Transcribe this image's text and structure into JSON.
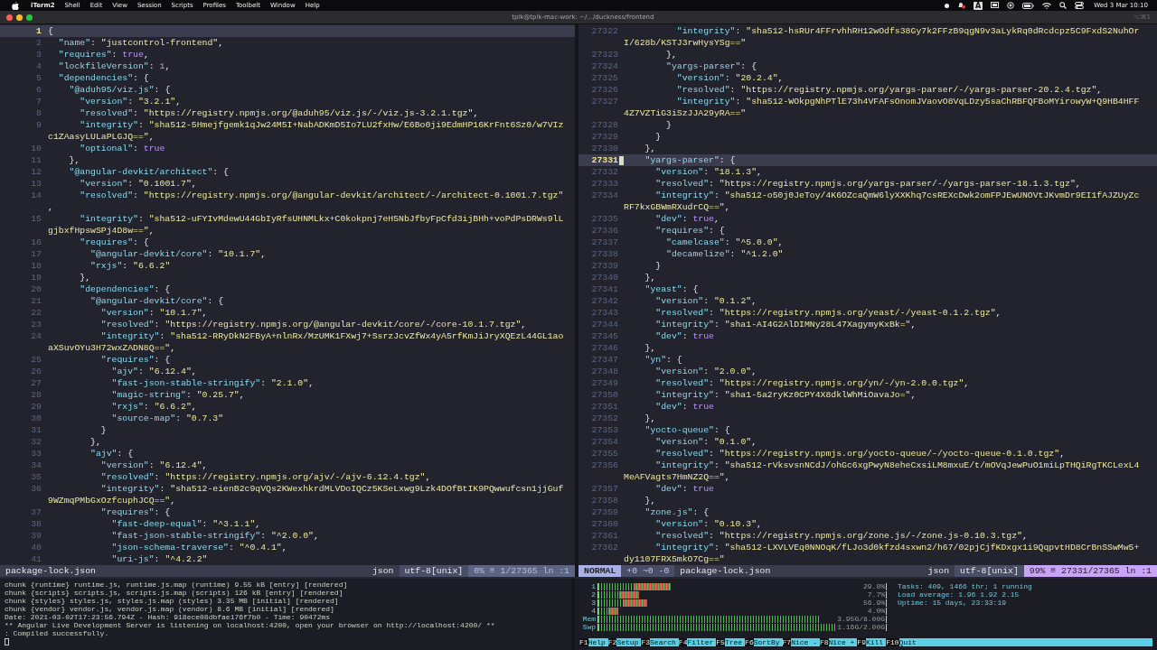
{
  "menubar": {
    "app_name": "iTerm2",
    "menus": [
      "Shell",
      "Edit",
      "View",
      "Session",
      "Scripts",
      "Profiles",
      "Toolbelt",
      "Window",
      "Help"
    ],
    "input_source": "A",
    "clock": "Wed 3 Mar 10:10"
  },
  "window": {
    "title": "tplk@tplk-mac-work: ~/.../duckness/frontend",
    "shortcut": "⌥⌘1"
  },
  "panes": [
    {
      "active": false,
      "lines": [
        {
          "number": "1",
          "text": "{",
          "current": true
        },
        {
          "number": "2",
          "text": "  \"name\": \"justcontrol-frontend\",",
          "current": false
        },
        {
          "number": "3",
          "text": "  \"requires\": true,",
          "current": false
        },
        {
          "number": "4",
          "text": "  \"lockfileVersion\": 1,",
          "current": false
        },
        {
          "number": "5",
          "text": "  \"dependencies\": {",
          "current": false
        },
        {
          "number": "6",
          "text": "    \"@aduh95/viz.js\": {",
          "current": false
        },
        {
          "number": "7",
          "text": "      \"version\": \"3.2.1\",",
          "current": false
        },
        {
          "number": "8",
          "text": "      \"resolved\": \"https://registry.npmjs.org/@aduh95/viz.js/-/viz.js-3.2.1.tgz\",",
          "current": false
        },
        {
          "number": "9",
          "text": "      \"integrity\": \"sha512-5Hmejfgemk1qJw24M5I+NabADKmD5Io7LU2fxHw/E6Bo0ji9EdmHP16KrFnt6Sz0/w7VIz",
          "continuation": "c1ZAasyLULaPLGJQ==\",",
          "current": false
        },
        {
          "number": "10",
          "text": "      \"optional\": true",
          "current": false
        },
        {
          "number": "11",
          "text": "    },",
          "current": false
        },
        {
          "number": "12",
          "text": "    \"@angular-devkit/architect\": {",
          "current": false
        },
        {
          "number": "13",
          "text": "      \"version\": \"0.1001.7\",",
          "current": false
        },
        {
          "number": "14",
          "text": "      \"resolved\": \"https://registry.npmjs.org/@angular-devkit/architect/-/architect-0.1001.7.tgz\"",
          "continuation": ",",
          "current": false
        },
        {
          "number": "15",
          "text": "      \"integrity\": \"sha512-uFYIvMdewU44GbIyRfsUHNMLkx+C0kokpnj7eH5NbJfbyFpCfd3ijBHh+voPdPsDRWs9lL",
          "continuation": "gjbxfHpswSPj4D8w==\",",
          "current": false
        },
        {
          "number": "16",
          "text": "      \"requires\": {",
          "current": false
        },
        {
          "number": "17",
          "text": "        \"@angular-devkit/core\": \"10.1.7\",",
          "current": false
        },
        {
          "number": "18",
          "text": "        \"rxjs\": \"6.6.2\"",
          "current": false
        },
        {
          "number": "19",
          "text": "      },",
          "current": false
        },
        {
          "number": "20",
          "text": "      \"dependencies\": {",
          "current": false
        },
        {
          "number": "21",
          "text": "        \"@angular-devkit/core\": {",
          "current": false
        },
        {
          "number": "22",
          "text": "          \"version\": \"10.1.7\",",
          "current": false
        },
        {
          "number": "23",
          "text": "          \"resolved\": \"https://registry.npmjs.org/@angular-devkit/core/-/core-10.1.7.tgz\",",
          "current": false
        },
        {
          "number": "24",
          "text": "          \"integrity\": \"sha512-RRyDkN2FByA+nlnRx/MzUMK1FXwj7+SsrzJcvZfWx4yA5rfKmJiJryXQEzL44GL1ao",
          "continuation": "aXSuvOYu3H72wxZADN8Q==\",",
          "current": false
        },
        {
          "number": "25",
          "text": "          \"requires\": {",
          "current": false
        },
        {
          "number": "26",
          "text": "            \"ajv\": \"6.12.4\",",
          "current": false
        },
        {
          "number": "27",
          "text": "            \"fast-json-stable-stringify\": \"2.1.0\",",
          "current": false
        },
        {
          "number": "28",
          "text": "            \"magic-string\": \"0.25.7\",",
          "current": false
        },
        {
          "number": "29",
          "text": "            \"rxjs\": \"6.6.2\",",
          "current": false
        },
        {
          "number": "30",
          "text": "            \"source-map\": \"0.7.3\"",
          "current": false
        },
        {
          "number": "31",
          "text": "          }",
          "current": false
        },
        {
          "number": "32",
          "text": "        },",
          "current": false
        },
        {
          "number": "33",
          "text": "        \"ajv\": {",
          "current": false
        },
        {
          "number": "34",
          "text": "          \"version\": \"6.12.4\",",
          "current": false
        },
        {
          "number": "35",
          "text": "          \"resolved\": \"https://registry.npmjs.org/ajv/-/ajv-6.12.4.tgz\",",
          "current": false
        },
        {
          "number": "36",
          "text": "          \"integrity\": \"sha512-eienB2c9qVQs2KWexhkrdMLVDoIQCz5KSeLxwg9Lzk4DOfBtIK9PQwwufcsn1jjGuf",
          "continuation": "9WZmqPMbGxOzfcuphJCQ==\",",
          "current": false
        },
        {
          "number": "37",
          "text": "          \"requires\": {",
          "current": false
        },
        {
          "number": "38",
          "text": "            \"fast-deep-equal\": \"^3.1.1\",",
          "current": false
        },
        {
          "number": "39",
          "text": "            \"fast-json-stable-stringify\": \"^2.0.0\",",
          "current": false
        },
        {
          "number": "40",
          "text": "            \"json-schema-traverse\": \"^0.4.1\",",
          "current": false
        },
        {
          "number": "41",
          "text": "            \"uri-js\": \"^4.2.2\"",
          "current": false
        }
      ],
      "status": {
        "file": "package-lock.json",
        "filetype": "json",
        "encoding": "utf-8[unix]",
        "position": "0% ≡ 1/27365 ln :1"
      }
    },
    {
      "active": true,
      "lines": [
        {
          "number": "27322",
          "text": "          \"integrity\": \"sha512-hsRUr4FFrvhhRH12wOdfs38Gy7k2FFzB9qgN9v3aLykRq0dRcdcpz5C9FxdS2NuhOr",
          "continuation": "I/628b/KSTJ3rwHysYSg==\"",
          "current": false
        },
        {
          "number": "27323",
          "text": "        },",
          "current": false
        },
        {
          "number": "27324",
          "text": "        \"yargs-parser\": {",
          "current": false
        },
        {
          "number": "27325",
          "text": "          \"version\": \"20.2.4\",",
          "current": false
        },
        {
          "number": "27326",
          "text": "          \"resolved\": \"https://registry.npmjs.org/yargs-parser/-/yargs-parser-20.2.4.tgz\",",
          "current": false
        },
        {
          "number": "27327",
          "text": "          \"integrity\": \"sha512-WOkpgNhPTlE73h4VFAFsOnomJVaovO8VqLDzy5saChRBFQFBoMYirowyW+Q9HB4HFF",
          "continuation": "4Z7VZTiG3iSzJJA29yRA==\"",
          "current": false
        },
        {
          "number": "27328",
          "text": "        }",
          "current": false
        },
        {
          "number": "27329",
          "text": "      }",
          "current": false
        },
        {
          "number": "27330",
          "text": "    },",
          "current": false
        },
        {
          "number": "27331",
          "text": "    \"yargs-parser\": {",
          "current": true
        },
        {
          "number": "27332",
          "text": "      \"version\": \"18.1.3\",",
          "current": false
        },
        {
          "number": "27333",
          "text": "      \"resolved\": \"https://registry.npmjs.org/yargs-parser/-/yargs-parser-18.1.3.tgz\",",
          "current": false
        },
        {
          "number": "27334",
          "text": "      \"integrity\": \"sha512-o50j0JeToy/4K6OZcaQmW6lyXXKhq7csREXcDwk2omFPJEwUNOVtJKvmDr9EI1fAJZUyZc",
          "continuation": "RF7kxGBWmRXudrCQ==\",",
          "current": false
        },
        {
          "number": "27335",
          "text": "      \"dev\": true,",
          "current": false
        },
        {
          "number": "27336",
          "text": "      \"requires\": {",
          "current": false
        },
        {
          "number": "27337",
          "text": "        \"camelcase\": \"^5.0.0\",",
          "current": false
        },
        {
          "number": "27338",
          "text": "        \"decamelize\": \"^1.2.0\"",
          "current": false
        },
        {
          "number": "27339",
          "text": "      }",
          "current": false
        },
        {
          "number": "27340",
          "text": "    },",
          "current": false
        },
        {
          "number": "27341",
          "text": "    \"yeast\": {",
          "current": false
        },
        {
          "number": "27342",
          "text": "      \"version\": \"0.1.2\",",
          "current": false
        },
        {
          "number": "27343",
          "text": "      \"resolved\": \"https://registry.npmjs.org/yeast/-/yeast-0.1.2.tgz\",",
          "current": false
        },
        {
          "number": "27344",
          "text": "      \"integrity\": \"sha1-AI4G2AlDIMNy28L47XagymyKxBk=\",",
          "current": false
        },
        {
          "number": "27345",
          "text": "      \"dev\": true",
          "current": false
        },
        {
          "number": "27346",
          "text": "    },",
          "current": false
        },
        {
          "number": "27347",
          "text": "    \"yn\": {",
          "current": false
        },
        {
          "number": "27348",
          "text": "      \"version\": \"2.0.0\",",
          "current": false
        },
        {
          "number": "27349",
          "text": "      \"resolved\": \"https://registry.npmjs.org/yn/-/yn-2.0.0.tgz\",",
          "current": false
        },
        {
          "number": "27350",
          "text": "      \"integrity\": \"sha1-5a2ryKz0CPY4X8dklWhMiOavaJo=\",",
          "current": false
        },
        {
          "number": "27351",
          "text": "      \"dev\": true",
          "current": false
        },
        {
          "number": "27352",
          "text": "    },",
          "current": false
        },
        {
          "number": "27353",
          "text": "    \"yocto-queue\": {",
          "current": false
        },
        {
          "number": "27354",
          "text": "      \"version\": \"0.1.0\",",
          "current": false
        },
        {
          "number": "27355",
          "text": "      \"resolved\": \"https://registry.npmjs.org/yocto-queue/-/yocto-queue-0.1.0.tgz\",",
          "current": false
        },
        {
          "number": "27356",
          "text": "      \"integrity\": \"sha512-rVksvsnNCdJ/ohGc6xgPwyN8eheCxsiLM8mxuE/t/mOVqJewPuO1miLpTHQiRgTKCLexL4",
          "continuation": "MeAFVagts7HmNZ2Q==\",",
          "current": false
        },
        {
          "number": "27357",
          "text": "      \"dev\": true",
          "current": false
        },
        {
          "number": "27358",
          "text": "    },",
          "current": false
        },
        {
          "number": "27359",
          "text": "    \"zone.js\": {",
          "current": false
        },
        {
          "number": "27360",
          "text": "      \"version\": \"0.10.3\",",
          "current": false
        },
        {
          "number": "27361",
          "text": "      \"resolved\": \"https://registry.npmjs.org/zone.js/-/zone.js-0.10.3.tgz\",",
          "current": false
        },
        {
          "number": "27362",
          "text": "      \"integrity\": \"sha512-LXVLVEq0NNOqK/fLJo3d0kfzd4sxwn2/h67/02pjCjfKDxgx1i9QqpvtHD8CrBnSSwMw5+",
          "continuation": "dy1107FRX5mkO7Cg==\"",
          "current": false
        }
      ],
      "status": {
        "mode": "NORMAL",
        "git": "+0 ~0 -0",
        "file": "package-lock.json",
        "filetype": "json",
        "encoding": "utf-8[unix]",
        "position": "99% ≡ 27331/27365 ln :1"
      }
    }
  ],
  "terminal": {
    "lines": [
      "chunk {runtime} runtime.js, runtime.js.map (runtime) 9.55 kB [entry] [rendered]",
      "chunk {scripts} scripts.js, scripts.js.map (scripts) 126 kB [entry] [rendered]",
      "chunk {styles} styles.js, styles.js.map (styles) 3.35 MB [initial] [rendered]",
      "chunk {vendor} vendor.js, vendor.js.map (vendor) 8.6 MB [initial] [rendered]",
      "Date: 2021-03-02T17:23:56.794Z - Hash: 918ece08dbfae176f7b0 - Time: 90472ms",
      "** Angular Live Development Server is listening on localhost:4200, open your browser on http://localhost:4200/ **",
      ": Compiled successfully."
    ]
  },
  "htop": {
    "meters": [
      {
        "label": "1",
        "level": 0.25,
        "reading": "29.8%"
      },
      {
        "label": "2",
        "level": 0.14,
        "reading": "7.7%"
      },
      {
        "label": "3",
        "level": 0.17,
        "reading": "56.9%"
      },
      {
        "label": "4",
        "level": 0.07,
        "reading": "4.0%"
      },
      {
        "label": "Mem",
        "level": 0.77,
        "reading": "3.95G/8.00G"
      },
      {
        "label": "Swp",
        "level": 0.97,
        "reading": "1.16G/2.00G"
      }
    ],
    "info": [
      "Tasks: 409, 1466 thr; 1 running",
      "Load average: 1.96 1.92 2.15",
      "Uptime: 15 days, 23:33:19"
    ],
    "function_keys": [
      {
        "key": "F1",
        "label": "Help"
      },
      {
        "key": "F2",
        "label": "Setup"
      },
      {
        "key": "F3",
        "label": "Search"
      },
      {
        "key": "F4",
        "label": "Filter"
      },
      {
        "key": "F5",
        "label": "Tree"
      },
      {
        "key": "F6",
        "label": "SortBy"
      },
      {
        "key": "F7",
        "label": "Nice -"
      },
      {
        "key": "F8",
        "label": "Nice +"
      },
      {
        "key": "F9",
        "label": "Kill"
      },
      {
        "key": "F10",
        "label": "Quit"
      }
    ]
  }
}
